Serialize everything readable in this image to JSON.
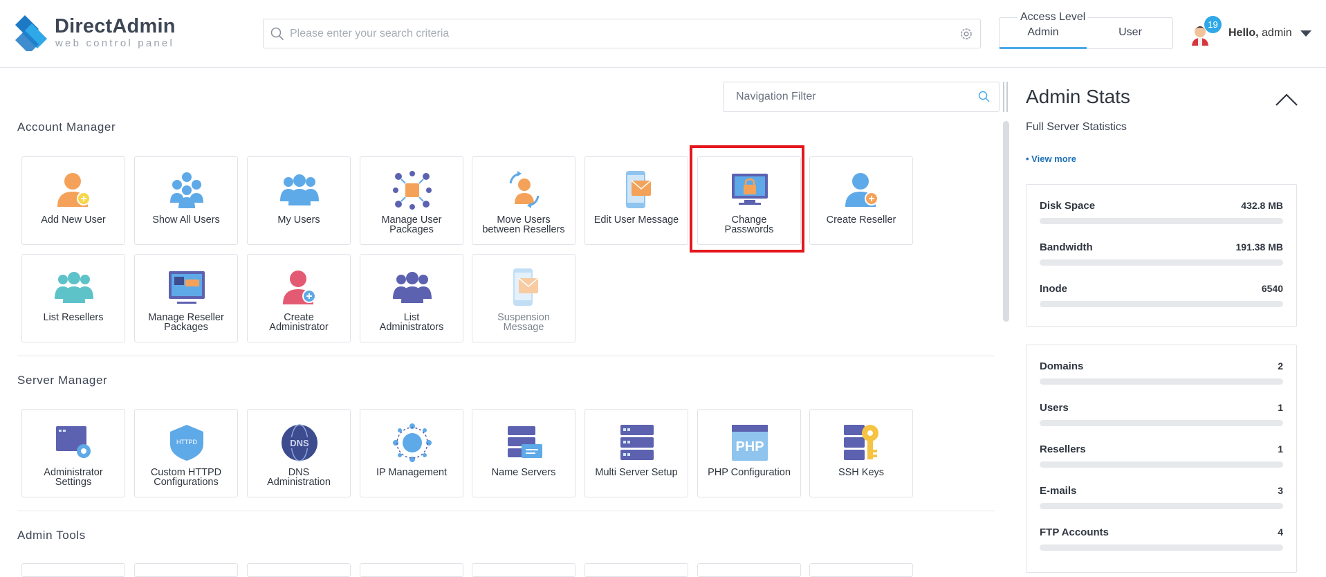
{
  "brand": {
    "name": "DirectAdmin",
    "tagline": "web control panel"
  },
  "search": {
    "placeholder": "Please enter your search criteria"
  },
  "access_level": {
    "title": "Access Level",
    "tabs": [
      "Admin",
      "User"
    ],
    "selected": "Admin"
  },
  "user": {
    "notifications": "19",
    "greeting": "Hello,",
    "name": "admin"
  },
  "nav_filter": {
    "placeholder": "Navigation Filter"
  },
  "sections": {
    "account_manager": {
      "title": "Account Manager",
      "tiles": [
        [
          "Add New User"
        ],
        [
          "Show All Users"
        ],
        [
          "My Users"
        ],
        [
          "Manage User",
          "Packages"
        ],
        [
          "Move Users",
          "between Resellers"
        ],
        [
          "Edit User Message"
        ],
        [
          "Change",
          "Passwords"
        ],
        [
          "Create Reseller"
        ],
        [
          "List Resellers"
        ],
        [
          "Manage Reseller",
          "Packages"
        ],
        [
          "Create",
          "Administrator"
        ],
        [
          "List",
          "Administrators"
        ],
        [
          "Suspension",
          "Message"
        ]
      ]
    },
    "server_manager": {
      "title": "Server Manager",
      "tiles": [
        [
          "Administrator",
          "Settings"
        ],
        [
          "Custom HTTPD",
          "Configurations"
        ],
        [
          "DNS",
          "Administration"
        ],
        [
          "IP Management"
        ],
        [
          "Name Servers"
        ],
        [
          "Multi Server Setup"
        ],
        [
          "PHP Configuration"
        ],
        [
          "SSH Keys"
        ]
      ]
    },
    "admin_tools": {
      "title": "Admin Tools"
    }
  },
  "icon_text": {
    "httpd": "HTTPD",
    "dns": "DNS",
    "php": "PHP"
  },
  "stats": {
    "title": "Admin Stats",
    "subtitle": "Full Server Statistics",
    "view_more": "• View more",
    "group1": [
      {
        "name": "Disk Space",
        "value": "432.8 MB"
      },
      {
        "name": "Bandwidth",
        "value": "191.38 MB"
      },
      {
        "name": "Inode",
        "value": "6540"
      }
    ],
    "group2": [
      {
        "name": "Domains",
        "value": "2"
      },
      {
        "name": "Users",
        "value": "1"
      },
      {
        "name": "Resellers",
        "value": "1"
      },
      {
        "name": "E-mails",
        "value": "3"
      },
      {
        "name": "FTP Accounts",
        "value": "4"
      }
    ]
  },
  "colors": {
    "accent": "#4aa9e9",
    "highlight": "#e4161e",
    "link": "#1d6fb7",
    "badge": "#2ea8e6"
  }
}
